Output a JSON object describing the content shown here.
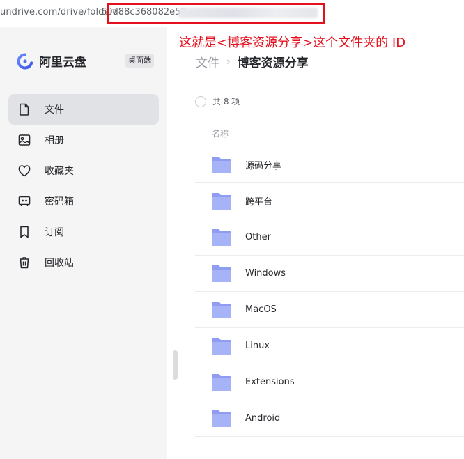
{
  "url": {
    "visible_text": "undrive.com/drive/folder/",
    "id_visible": "60d88c368082e58"
  },
  "annotation": {
    "text": "这就是<博客资源分享>这个文件夹的 ID",
    "color": "#e5101d"
  },
  "sidebar": {
    "brand_name": "阿里云盘",
    "desktop_badge": "桌面端",
    "items": [
      {
        "label": "文件",
        "icon": "file-icon",
        "active": true
      },
      {
        "label": "相册",
        "icon": "photo-album-icon",
        "active": false
      },
      {
        "label": "收藏夹",
        "icon": "heart-icon",
        "active": false
      },
      {
        "label": "密码箱",
        "icon": "safe-box-icon",
        "active": false
      },
      {
        "label": "订阅",
        "icon": "bookmark-icon",
        "active": false
      },
      {
        "label": "回收站",
        "icon": "trash-icon",
        "active": false
      }
    ]
  },
  "main": {
    "breadcrumb_root": "文件",
    "breadcrumb_separator": "›",
    "breadcrumb_current": "博客资源分享",
    "count_text": "共 8 项",
    "column_name": "名称",
    "files": [
      {
        "name": "源码分享",
        "icon": "folder-icon"
      },
      {
        "name": "跨平台",
        "icon": "folder-icon"
      },
      {
        "name": "Other",
        "icon": "folder-icon"
      },
      {
        "name": "Windows",
        "icon": "folder-icon"
      },
      {
        "name": "MacOS",
        "icon": "folder-icon"
      },
      {
        "name": "Linux",
        "icon": "folder-icon"
      },
      {
        "name": "Extensions",
        "icon": "folder-icon"
      },
      {
        "name": "Android",
        "icon": "folder-icon"
      }
    ]
  },
  "colors": {
    "accent": "#4a6ef5",
    "folder": "#8e9cf2",
    "highlight": "#e5101d"
  }
}
